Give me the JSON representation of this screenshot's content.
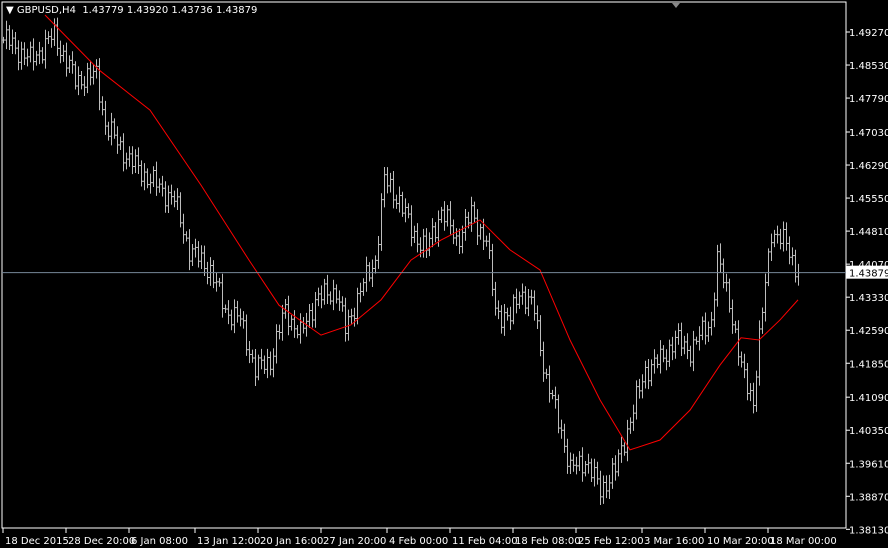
{
  "header": {
    "symbol": "GBPUSD,H4",
    "open": "1.43779",
    "high": "1.43920",
    "low": "1.43736",
    "close": "1.43879"
  },
  "colors": {
    "bars": "#bdbdbd",
    "ma": "#ff0000",
    "bid_line": "#778899",
    "axis": "#ffffff"
  },
  "chart_data": {
    "type": "ohlc",
    "title": "GBPUSD,H4",
    "ylim": [
      1.3813,
      1.4964
    ],
    "yticks": [
      "1.49270",
      "1.48530",
      "1.47790",
      "1.47030",
      "1.46290",
      "1.45550",
      "1.44810",
      "1.44070",
      "1.43330",
      "1.42590",
      "1.41850",
      "1.41090",
      "1.40350",
      "1.39610",
      "1.38870",
      "1.38130"
    ],
    "current_price": "1.43879",
    "bar_count": 266,
    "xticks": [
      {
        "bar": 0,
        "label": "18 Dec 2015"
      },
      {
        "bar": 21,
        "label": "28 Dec 20:00"
      },
      {
        "bar": 42,
        "label": "6 Jan 08:00"
      },
      {
        "bar": 64,
        "label": "13 Jan 12:00"
      },
      {
        "bar": 85,
        "label": "20 Jan 16:00"
      },
      {
        "bar": 106,
        "label": "27 Jan 20:00"
      },
      {
        "bar": 128,
        "label": "4 Feb 00:00"
      },
      {
        "bar": 149,
        "label": "11 Feb 04:00"
      },
      {
        "bar": 170,
        "label": "18 Feb 08:00"
      },
      {
        "bar": 191,
        "label": "25 Feb 12:00"
      },
      {
        "bar": 213,
        "label": "3 Mar 16:00"
      },
      {
        "bar": 234,
        "label": "10 Mar 20:00"
      },
      {
        "bar": 255,
        "label": "18 Mar 00:00"
      }
    ],
    "close_anchors": [
      [
        1,
        1.4909
      ],
      [
        9,
        1.4864
      ],
      [
        17,
        1.492
      ],
      [
        24,
        1.4819
      ],
      [
        31,
        1.4831
      ],
      [
        34,
        1.4719
      ],
      [
        42,
        1.464
      ],
      [
        49,
        1.4595
      ],
      [
        57,
        1.4551
      ],
      [
        62,
        1.4439
      ],
      [
        69,
        1.4394
      ],
      [
        74,
        1.4304
      ],
      [
        79,
        1.4282
      ],
      [
        84,
        1.417
      ],
      [
        89,
        1.4192
      ],
      [
        94,
        1.4304
      ],
      [
        99,
        1.4248
      ],
      [
        104,
        1.4327
      ],
      [
        111,
        1.4349
      ],
      [
        114,
        1.4259
      ],
      [
        119,
        1.4349
      ],
      [
        124,
        1.4416
      ],
      [
        127,
        1.4595
      ],
      [
        132,
        1.4551
      ],
      [
        136,
        1.4483
      ],
      [
        141,
        1.4439
      ],
      [
        146,
        1.4528
      ],
      [
        151,
        1.4461
      ],
      [
        156,
        1.4517
      ],
      [
        161,
        1.4461
      ],
      [
        164,
        1.4304
      ],
      [
        169,
        1.4282
      ],
      [
        172,
        1.4349
      ],
      [
        177,
        1.4304
      ],
      [
        181,
        1.4147
      ],
      [
        186,
        1.4035
      ],
      [
        189,
        1.3946
      ],
      [
        194,
        1.3968
      ],
      [
        199,
        1.3901
      ],
      [
        204,
        1.3946
      ],
      [
        209,
        1.4058
      ],
      [
        214,
        1.417
      ],
      [
        219,
        1.4192
      ],
      [
        224,
        1.4237
      ],
      [
        229,
        1.4215
      ],
      [
        236,
        1.4282
      ],
      [
        238,
        1.4416
      ],
      [
        242,
        1.4327
      ],
      [
        246,
        1.417
      ],
      [
        250,
        1.4103
      ],
      [
        252,
        1.4237
      ],
      [
        256,
        1.4483
      ],
      [
        261,
        1.445
      ],
      [
        265,
        1.4388
      ]
    ],
    "moving_average": [
      [
        14,
        1.4965
      ],
      [
        32,
        1.4842
      ],
      [
        49,
        1.4752
      ],
      [
        66,
        1.4584
      ],
      [
        82,
        1.4416
      ],
      [
        92,
        1.4315
      ],
      [
        106,
        1.4248
      ],
      [
        116,
        1.4271
      ],
      [
        126,
        1.4327
      ],
      [
        136,
        1.4416
      ],
      [
        146,
        1.4461
      ],
      [
        159,
        1.4506
      ],
      [
        169,
        1.4439
      ],
      [
        179,
        1.4394
      ],
      [
        189,
        1.4237
      ],
      [
        199,
        1.4103
      ],
      [
        209,
        1.3991
      ],
      [
        219,
        1.4013
      ],
      [
        229,
        1.408
      ],
      [
        239,
        1.4181
      ],
      [
        246,
        1.4242
      ],
      [
        252,
        1.4237
      ],
      [
        259,
        1.4282
      ],
      [
        265,
        1.4327
      ]
    ]
  }
}
